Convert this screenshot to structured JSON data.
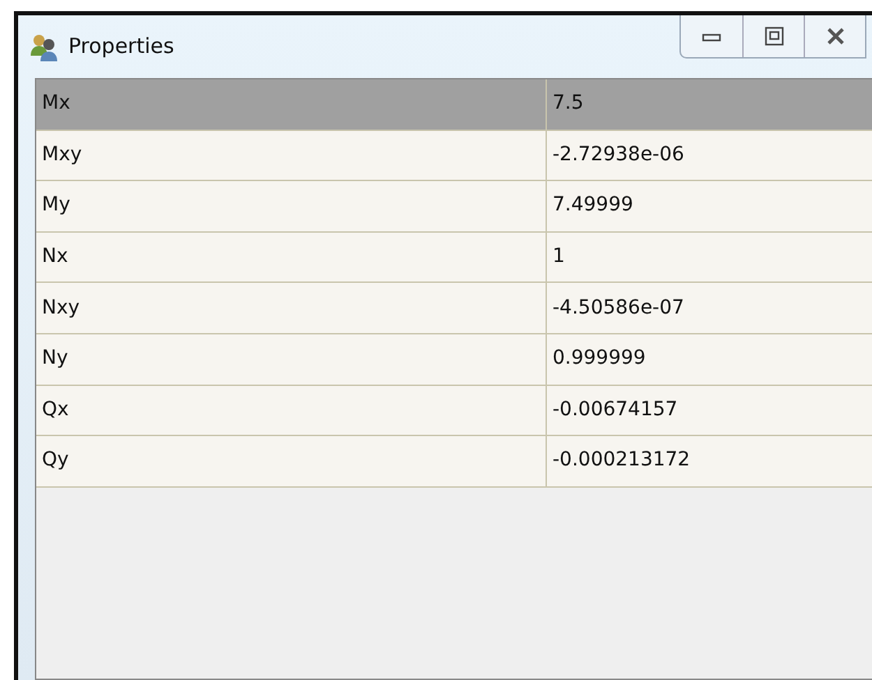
{
  "window": {
    "title": "Properties"
  },
  "properties": [
    {
      "name": "Mx",
      "value": "7.5",
      "selected": true
    },
    {
      "name": "Mxy",
      "value": "-2.72938e-06",
      "selected": false
    },
    {
      "name": "My",
      "value": "7.49999",
      "selected": false
    },
    {
      "name": "Nx",
      "value": "1",
      "selected": false
    },
    {
      "name": "Nxy",
      "value": "-4.50586e-07",
      "selected": false
    },
    {
      "name": "Ny",
      "value": "0.999999",
      "selected": false
    },
    {
      "name": "Qx",
      "value": "-0.00674157",
      "selected": false
    },
    {
      "name": "Qy",
      "value": "-0.000213172",
      "selected": false
    }
  ]
}
